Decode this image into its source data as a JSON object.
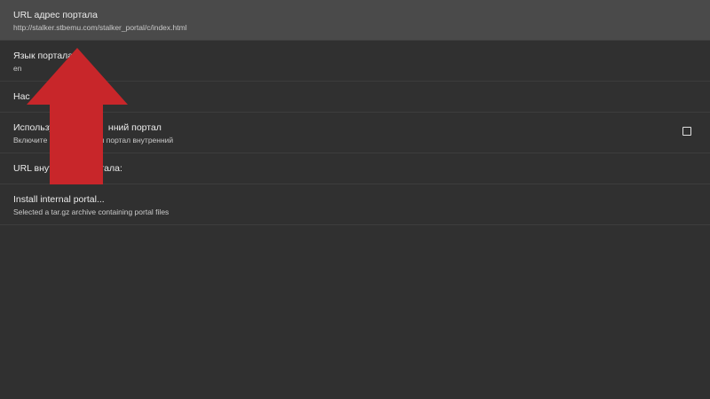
{
  "preferences": [
    {
      "title": "URL адрес портала",
      "summary": "http://stalker.stbemu.com/stalker_portal/c/index.html",
      "selected": true
    },
    {
      "title": "Язык портала",
      "summary": "en"
    },
    {
      "title": "Нас"
    },
    {
      "title": "Использу                     нний портал",
      "summary": "Включите                     или портал внутренний",
      "checkbox_checked": false
    },
    {
      "title": "URL внут                  тала:"
    },
    {
      "title": "Install internal portal...",
      "summary": "Selected a tar.gz archive containing portal files"
    }
  ],
  "overlay": {
    "arrow_color": "#c8262a",
    "arrow_icon": "red-up-arrow-icon"
  }
}
